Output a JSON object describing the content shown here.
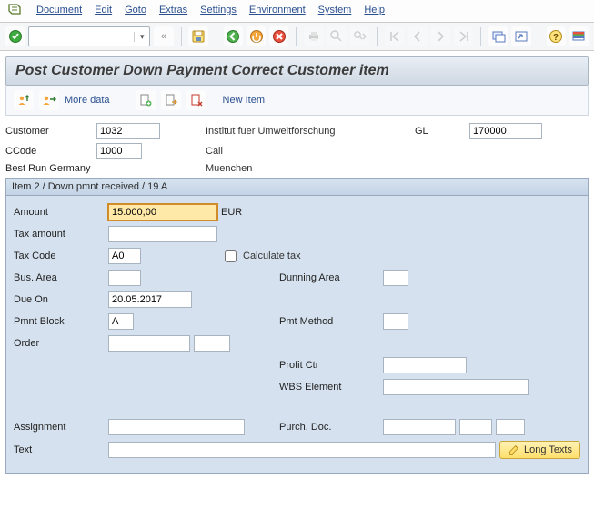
{
  "menu": {
    "document": "Document",
    "edit": "Edit",
    "goto": "Goto",
    "extras": "Extras",
    "settings": "Settings",
    "environment": "Environment",
    "system": "System",
    "help": "Help"
  },
  "title": "Post Customer Down Payment Correct Customer item",
  "subtoolbar": {
    "more_data": "More data",
    "new_item": "New Item"
  },
  "colors": {
    "accent": "#2a4f8f",
    "section_bg": "#d5e1ee",
    "focus_bg": "#ffe9a8"
  },
  "icons": {
    "sap_logo": "sap-logo",
    "check": "check-icon",
    "save": "save-icon",
    "back": "back-icon",
    "exit": "exit-icon",
    "cancel": "cancel-icon",
    "print": "print-icon",
    "find": "find-icon",
    "first": "first-icon",
    "prev": "prev-icon",
    "next": "next-icon",
    "last": "last-icon",
    "new_session": "new-session-icon",
    "shortcut": "shortcut-icon",
    "help": "help-icon",
    "layout": "layout-icon",
    "person_up": "person-up-icon",
    "person_right": "person-right-icon",
    "doc_new": "doc-new-icon",
    "doc_out": "doc-out-icon",
    "doc_del": "doc-del-icon",
    "pencil": "pencil-icon"
  },
  "header": {
    "customer_label": "Customer",
    "customer_value": "1032",
    "customer_name": "Institut fuer Umweltforschung",
    "gl_label": "GL",
    "gl_value": "170000",
    "ccode_label": "CCode",
    "ccode_value": "1000",
    "city1": "Cali",
    "company": "Best Run Germany",
    "city2": "Muenchen"
  },
  "section_title": "Item 2 / Down pmnt received / 19 A",
  "fields": {
    "amount_label": "Amount",
    "amount_value": "15.000,00",
    "currency": "EUR",
    "tax_amount_label": "Tax amount",
    "tax_amount_value": "",
    "tax_code_label": "Tax Code",
    "tax_code_value": "A0",
    "calc_tax_label": "Calculate tax",
    "bus_area_label": "Bus. Area",
    "bus_area_value": "",
    "dunning_area_label": "Dunning Area",
    "dunning_area_value": "",
    "due_on_label": "Due On",
    "due_on_value": "20.05.2017",
    "pmnt_block_label": "Pmnt Block",
    "pmnt_block_value": "A",
    "pmt_method_label": "Pmt Method",
    "pmt_method_value": "",
    "order_label": "Order",
    "order_value": "",
    "order_value2": "",
    "profit_ctr_label": "Profit Ctr",
    "profit_ctr_value": "",
    "wbs_label": "WBS Element",
    "wbs_value": "",
    "assignment_label": "Assignment",
    "assignment_value": "",
    "purch_doc_label": "Purch. Doc.",
    "purch_doc_value": "",
    "purch_doc_value2": "",
    "purch_doc_value3": "",
    "text_label": "Text",
    "text_value": "",
    "long_texts": "Long Texts"
  }
}
